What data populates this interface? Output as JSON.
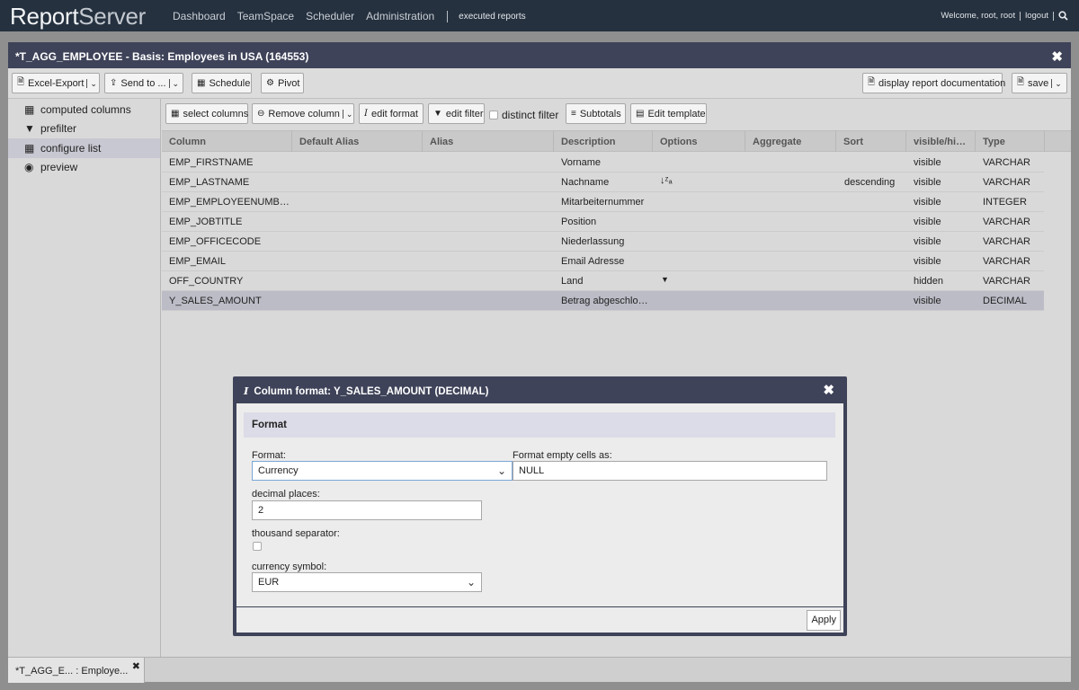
{
  "app": {
    "logo_bold": "Report",
    "logo_light": "Server",
    "nav": [
      "Dashboard",
      "TeamSpace",
      "Scheduler",
      "Administration"
    ],
    "executed_reports": "executed reports",
    "welcome": "Welcome, root, root",
    "logout": "logout"
  },
  "report": {
    "title": "*T_AGG_EMPLOYEE - Basis: Employees in USA (164553)",
    "close": "✖"
  },
  "toolbar": {
    "excel_export": "Excel-Export",
    "send_to": "Send to ...",
    "schedule": "Schedule",
    "pivot": "Pivot",
    "display_doc": "display report documentation",
    "save": "save"
  },
  "sidebar": {
    "items": [
      {
        "label": "computed columns",
        "icon": "table-icon"
      },
      {
        "label": "prefilter",
        "icon": "filter-icon"
      },
      {
        "label": "configure list",
        "icon": "grid-icon"
      },
      {
        "label": "preview",
        "icon": "eye-icon"
      }
    ]
  },
  "subtoolbar": {
    "select_columns": "select columns",
    "remove_column": "Remove column",
    "edit_format": "edit format",
    "edit_filter": "edit filter",
    "distinct_filter": "distinct filter",
    "subtotals": "Subtotals",
    "edit_template": "Edit template"
  },
  "grid": {
    "headers": [
      "Column",
      "Default Alias",
      "Alias",
      "Description",
      "Options",
      "Aggregate",
      "Sort",
      "visible/hi…",
      "Type"
    ],
    "rows": [
      {
        "column": "EMP_FIRSTNAME",
        "description": "Vorname",
        "option": "",
        "sort": "",
        "visible": "visible",
        "type": "VARCHAR"
      },
      {
        "column": "EMP_LASTNAME",
        "description": "Nachname",
        "option": "sort-icon",
        "sort": "descending",
        "visible": "visible",
        "type": "VARCHAR"
      },
      {
        "column": "EMP_EMPLOYEENUMB…",
        "description": "Mitarbeiternummer",
        "option": "",
        "sort": "",
        "visible": "visible",
        "type": "INTEGER"
      },
      {
        "column": "EMP_JOBTITLE",
        "description": "Position",
        "option": "",
        "sort": "",
        "visible": "visible",
        "type": "VARCHAR"
      },
      {
        "column": "EMP_OFFICECODE",
        "description": "Niederlassung",
        "option": "",
        "sort": "",
        "visible": "visible",
        "type": "VARCHAR"
      },
      {
        "column": "EMP_EMAIL",
        "description": "Email Adresse",
        "option": "",
        "sort": "",
        "visible": "visible",
        "type": "VARCHAR"
      },
      {
        "column": "OFF_COUNTRY",
        "description": "Land",
        "option": "filter-icon",
        "sort": "",
        "visible": "hidden",
        "type": "VARCHAR"
      },
      {
        "column": "Y_SALES_AMOUNT",
        "description": "Betrag abgeschlo…",
        "option": "",
        "sort": "",
        "visible": "visible",
        "type": "DECIMAL"
      }
    ]
  },
  "dialog": {
    "title": "Column format: Y_SALES_AMOUNT (DECIMAL)",
    "section": "Format",
    "format_label": "Format:",
    "format_value": "Currency",
    "empty_label": "Format empty cells as:",
    "empty_value": "NULL",
    "decimal_label": "decimal places:",
    "decimal_value": "2",
    "thousand_label": "thousand separator:",
    "thousand_checked": false,
    "currency_label": "currency symbol:",
    "currency_value": "EUR",
    "apply": "Apply"
  },
  "bottom_tab": {
    "label": "*T_AGG_E... : Employe..."
  },
  "colors": {
    "topbar": "#25313f",
    "titlebar": "#3f4359",
    "selected_row": "#bcbcc7",
    "section_header": "#dcdce8"
  }
}
